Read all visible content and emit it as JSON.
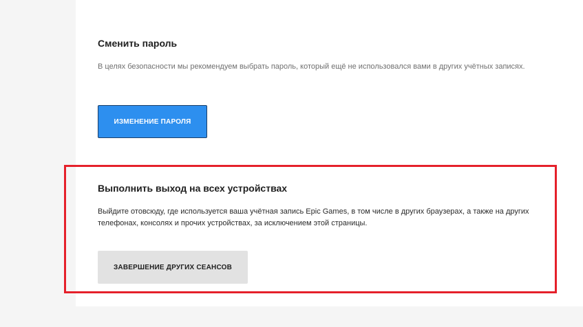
{
  "change_password": {
    "title": "Сменить пароль",
    "description": "В целях безопасности мы рекомендуем выбрать пароль, который ещё не использовался вами в других учётных записях.",
    "button_label": "ИЗМЕНЕНИЕ ПАРОЛЯ"
  },
  "sign_out_everywhere": {
    "title": "Выполнить выход на всех устройствах",
    "description": "Выйдите отовсюду, где используется ваша учётная запись Epic Games, в том числе в других браузерах, а также на других телефонах, консолях и прочих устройствах, за исключением этой страницы.",
    "button_label": "ЗАВЕРШЕНИЕ ДРУГИХ СЕАНСОВ"
  },
  "colors": {
    "primary_button": "#2d8fef",
    "secondary_button": "#e2e2e2",
    "highlight_border": "#e5202a"
  }
}
